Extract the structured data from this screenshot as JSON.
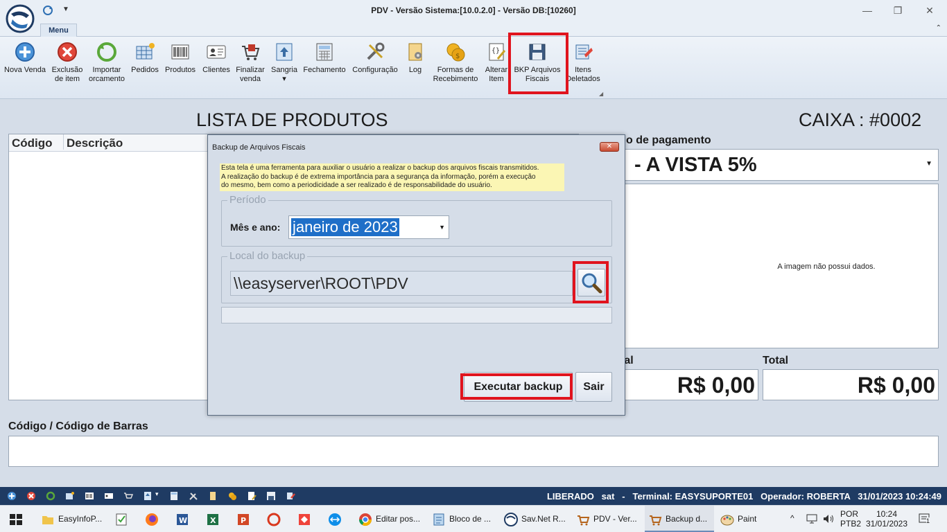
{
  "window": {
    "title": "PDV - Versão Sistema:[10.0.2.0] - Versão DB:[10260]",
    "minimize": "—",
    "restore": "❐",
    "close": "✕"
  },
  "ribbon": {
    "tab": "Menu",
    "buttons": [
      {
        "l1": "Nova Venda",
        "l2": ""
      },
      {
        "l1": "Exclusão",
        "l2": "de item"
      },
      {
        "l1": "Importar",
        "l2": "orcamento"
      },
      {
        "l1": "Pedidos",
        "l2": ""
      },
      {
        "l1": "Produtos",
        "l2": ""
      },
      {
        "l1": "Clientes",
        "l2": ""
      },
      {
        "l1": "Finalizar",
        "l2": "venda"
      },
      {
        "l1": "Sangria",
        "l2": "▾"
      },
      {
        "l1": "Fechamento",
        "l2": ""
      },
      {
        "l1": "Configuração",
        "l2": ""
      },
      {
        "l1": "Log",
        "l2": ""
      },
      {
        "l1": "Formas de",
        "l2": "Recebimento"
      },
      {
        "l1": "Alterar",
        "l2": "Item"
      },
      {
        "l1": "BKP Arquivos",
        "l2": "Fiscais"
      },
      {
        "l1": "Itens",
        "l2": "Deletados"
      }
    ]
  },
  "main": {
    "lista_title": "LISTA DE PRODUTOS",
    "caixa_title": "CAIXA : #0002",
    "col_codigo": "Código",
    "col_descricao": "Descrição",
    "pay_label": "o de pagamento",
    "pay_value": "- A VISTA 5%",
    "image_empty": "A imagem não possui dados.",
    "subtotal_label": "tal",
    "total_label": "Total",
    "subtotal_value": "R$ 0,00",
    "total_value": "R$ 0,00",
    "barcode_label": "Código / Código de Barras"
  },
  "dialog": {
    "title": "Backup de Arquivos Fiscais",
    "close": "✕",
    "info": [
      "Esta tela é uma ferramenta para auxiliar o usuário a realizar o backup dos arquivos fiscais transmitidos.",
      "A realização do backup é de extrema importância para a segurança da informação, porém a execução",
      "do mesmo, bem como a periodicidade a ser realizado é de responsabilidade do usuário."
    ],
    "periodo_legend": "Período",
    "mes_label": "Mês e ano:",
    "mes_value": "janeiro de 2023",
    "local_legend": "Local do backup",
    "path": "\\\\easyserver\\ROOT\\PDV",
    "executar": "Executar backup",
    "sair": "Sair"
  },
  "statusbar": {
    "text": "LIBERADO   sat   -   Terminal: EASYSUPORTE01   Operador: ROBERTA   31/01/2023 10:24:49"
  },
  "taskbar": {
    "items": [
      "EasyInfoP...",
      "",
      "",
      "",
      "",
      "",
      "",
      "",
      "",
      "Editar pos...",
      "Bloco de ...",
      "Sav.Net R...",
      "PDV - Ver...",
      "Backup d...",
      "Paint"
    ],
    "lang1": "POR",
    "lang2": "PTB2",
    "time": "10:24",
    "date": "31/01/2023",
    "notif": "1"
  },
  "colors": {
    "highlight": "#e0141e",
    "statusbar": "#1f3b63",
    "selection": "#1f6fc8",
    "info_bg": "#fbf6b4"
  }
}
